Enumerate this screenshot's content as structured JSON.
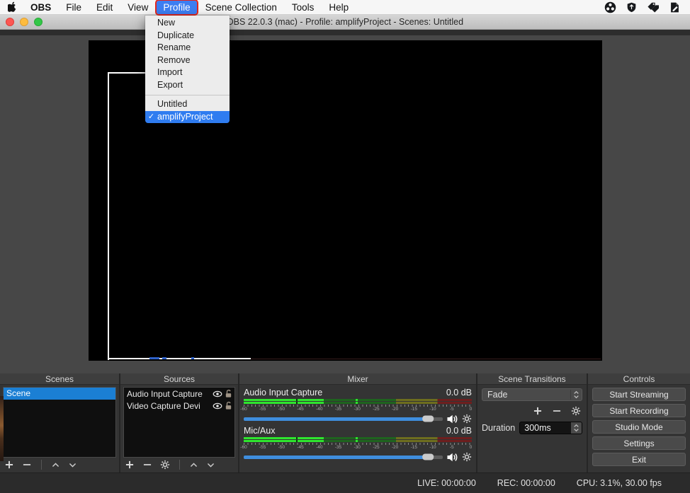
{
  "menubar": {
    "items": [
      {
        "label": "OBS",
        "bold": true
      },
      {
        "label": "File"
      },
      {
        "label": "Edit"
      },
      {
        "label": "View"
      },
      {
        "label": "Profile",
        "selected": true,
        "annotated": true
      },
      {
        "label": "Scene Collection"
      },
      {
        "label": "Tools"
      },
      {
        "label": "Help"
      }
    ],
    "status_icons": [
      "obs-logo-icon",
      "shield-icon",
      "tags-icon",
      "document-edit-icon"
    ]
  },
  "titlebar": {
    "title": "OBS 22.0.3 (mac) - Profile: amplifyProject - Scenes: Untitled"
  },
  "profile_menu": {
    "actions": [
      "New",
      "Duplicate",
      "Rename",
      "Remove",
      "Import",
      "Export"
    ],
    "profiles": [
      {
        "label": "Untitled",
        "checked": false,
        "selected": false
      },
      {
        "label": "amplifyProject",
        "checked": true,
        "selected": true
      }
    ],
    "checkmark": "✓"
  },
  "panels": {
    "scenes": {
      "title": "Scenes",
      "items": [
        {
          "label": "Scene",
          "selected": true
        }
      ]
    },
    "sources": {
      "title": "Sources",
      "items": [
        {
          "label": "Audio Input Capture"
        },
        {
          "label": "Video Capture Devi"
        }
      ]
    },
    "mixer": {
      "title": "Mixer",
      "ticks": [
        "-60",
        "-55",
        "-50",
        "-45",
        "-40",
        "-35",
        "-30",
        "-25",
        "-20",
        "-15",
        "-10",
        "-5",
        "0"
      ],
      "channels": [
        {
          "name": "Audio Input Capture",
          "db": "0.0 dB",
          "level_pct": 35,
          "notch_pct": 23,
          "peak_pct": 49,
          "slider_pct": 93
        },
        {
          "name": "Mic/Aux",
          "db": "0.0 dB",
          "level_pct": 35,
          "notch_pct": 23,
          "peak_pct": 49,
          "slider_pct": 93
        }
      ]
    },
    "transitions": {
      "title": "Scene Transitions",
      "transition": "Fade",
      "duration_label": "Duration",
      "duration_value": "300ms"
    },
    "controls": {
      "title": "Controls",
      "buttons": [
        "Start Streaming",
        "Start Recording",
        "Studio Mode",
        "Settings",
        "Exit"
      ]
    }
  },
  "statusbar": {
    "live": "LIVE: 00:00:00",
    "rec": "REC: 00:00:00",
    "cpu": "CPU: 3.1%, 30.00 fps"
  },
  "colors": {
    "selection_blue": "#1b7fd4",
    "menu_highlight": "#2f7cf0",
    "menubar_highlight": "#3d7ef2",
    "annotation_red": "#e3261d",
    "slider_blue": "#3f8ede",
    "meter_green_bright": "#2ee62e",
    "meter_green_dim": "#1e641e",
    "meter_yellow_dim": "#6e6e1e",
    "meter_red_dim": "#6e1e1e"
  }
}
